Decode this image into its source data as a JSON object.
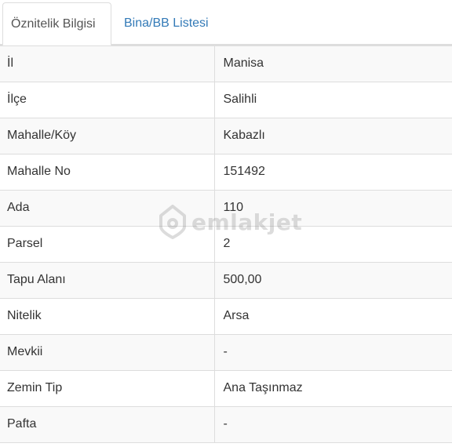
{
  "tabs": [
    {
      "label": "Öznitelik Bilgisi",
      "active": true
    },
    {
      "label": "Bina/BB Listesi",
      "active": false
    }
  ],
  "rows": [
    {
      "key": "İl",
      "value": "Manisa"
    },
    {
      "key": "İlçe",
      "value": "Salihli"
    },
    {
      "key": "Mahalle/Köy",
      "value": "Kabazlı"
    },
    {
      "key": "Mahalle No",
      "value": "151492"
    },
    {
      "key": "Ada",
      "value": "110"
    },
    {
      "key": "Parsel",
      "value": "2"
    },
    {
      "key": "Tapu Alanı",
      "value": "500,00"
    },
    {
      "key": "Nitelik",
      "value": "Arsa"
    },
    {
      "key": "Mevkii",
      "value": "-"
    },
    {
      "key": "Zemin Tip",
      "value": "Ana Taşınmaz"
    },
    {
      "key": "Pafta",
      "value": "-"
    }
  ],
  "watermark": {
    "text": "emlakjet",
    "icon": "house-pin-icon"
  },
  "colors": {
    "link": "#337ab7",
    "border": "#dddddd",
    "stripe": "#f9f9f9",
    "text": "#333333"
  }
}
